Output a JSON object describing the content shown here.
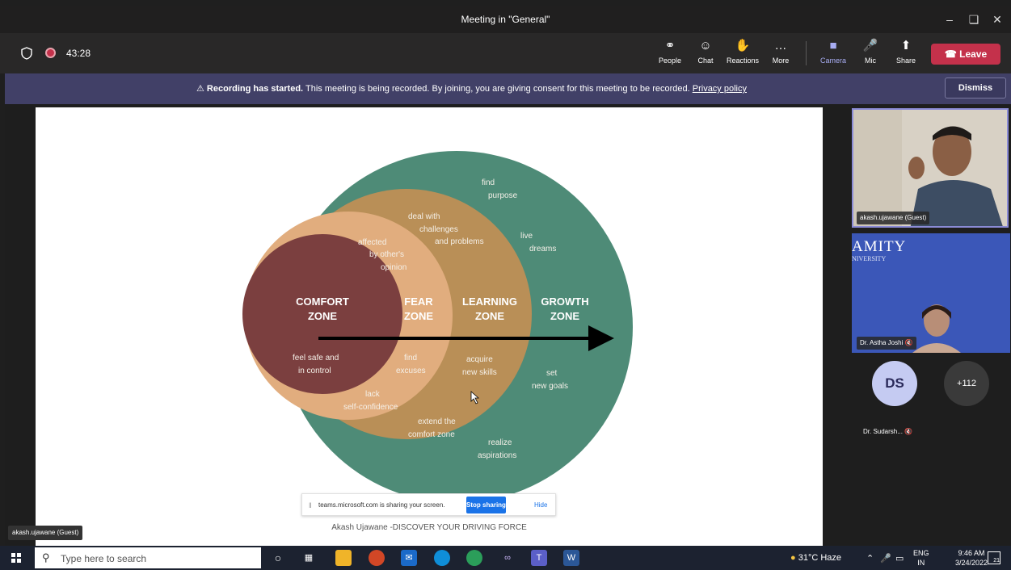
{
  "window": {
    "title": "Meeting in \"General\"",
    "minimize_icon": "minimize-icon",
    "restore_icon": "restore-icon",
    "close_icon": "close-icon"
  },
  "toolbar": {
    "timer": "43:28",
    "buttons": [
      {
        "label": "People",
        "icon": "people-icon"
      },
      {
        "label": "Chat",
        "icon": "chat-icon"
      },
      {
        "label": "Reactions",
        "icon": "reactions-icon"
      },
      {
        "label": "More",
        "icon": "more-icon"
      },
      {
        "label": "Camera",
        "icon": "camera-icon"
      },
      {
        "label": "Mic",
        "icon": "mic-off-icon"
      },
      {
        "label": "Share",
        "icon": "share-icon"
      }
    ],
    "leave_label": "Leave"
  },
  "banner": {
    "strong": "Recording has started.",
    "text": " This meeting is being recorded. By joining, you are giving consent for this meeting to be recorded. ",
    "link": "Privacy policy",
    "dismiss": "Dismiss"
  },
  "slide": {
    "zones": [
      {
        "title1": "COMFORT",
        "title2": "ZONE",
        "color": "#7b3f3f"
      },
      {
        "title1": "FEAR",
        "title2": "ZONE",
        "color": "#e1ad7e"
      },
      {
        "title1": "LEARNING",
        "title2": "ZONE",
        "color": "#b98f57"
      },
      {
        "title1": "GROWTH",
        "title2": "ZONE",
        "color": "#4e8b77"
      }
    ],
    "labels": {
      "find_purpose_1": "find",
      "find_purpose_2": "purpose",
      "deal_1": "deal with",
      "deal_2": "challenges",
      "deal_3": "and problems",
      "live_1": "live",
      "live_2": "dreams",
      "affected_1": "affected",
      "affected_2": "by other's",
      "affected_3": "opinion",
      "feel_1": "feel safe and",
      "feel_2": "in control",
      "excuses_1": "find",
      "excuses_2": "excuses",
      "acquire_1": "acquire",
      "acquire_2": "new skills",
      "set_1": "set",
      "set_2": "new goals",
      "lack_1": "lack",
      "lack_2": "self-confidence",
      "extend_1": "extend the",
      "extend_2": "comfort zone",
      "realize_1": "realize",
      "realize_2": "aspirations"
    },
    "caption": "Akash Ujawane -DISCOVER YOUR DRIVING FORCE"
  },
  "sharebar": {
    "text": "teams.microsoft.com is sharing your screen.",
    "stop": "Stop sharing",
    "hide": "Hide"
  },
  "presenter_tag": "akash.ujawane (Guest)",
  "participants": {
    "tile1_name": "akash.ujawane (Guest)",
    "tile2_name": "Dr. Astha Joshi",
    "tile2_logo": "AMITY",
    "tile2_logo_sub": "NIVERSITY",
    "avatar_initials": "DS",
    "avatar_name": "Dr. Sudarsh...",
    "more_count": "+112"
  },
  "taskbar": {
    "search_placeholder": "Type here to search",
    "weather": "31°C  Haze",
    "lang1": "ENG",
    "lang2": "IN",
    "time": "9:46 AM",
    "date": "3/24/2022",
    "notifications": "21"
  }
}
